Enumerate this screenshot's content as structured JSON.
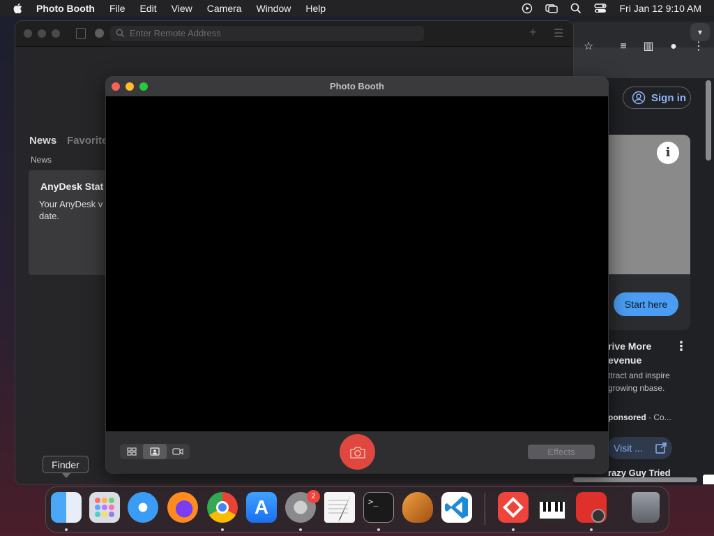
{
  "menubar": {
    "app": "Photo Booth",
    "items": [
      "File",
      "Edit",
      "View",
      "Camera",
      "Window",
      "Help"
    ],
    "clock": "Fri Jan 12  9:10 AM"
  },
  "anydesk": {
    "address_placeholder": "Enter Remote Address",
    "tab_news": "News",
    "tab_favorites": "Favorite",
    "section_label": "News",
    "news_title": "AnyDesk Stat",
    "news_body": "Your AnyDesk v to date."
  },
  "photobooth": {
    "title": "Photo Booth",
    "effects_label": "Effects"
  },
  "chrome": {
    "sign_in": "Sign in",
    "start_here": "Start here",
    "ad_title": "rive More evenue",
    "ad_desc": "ttract and inspire growing nbase.",
    "ad_sponsored": "ponsored",
    "ad_sponsored_suffix": "· Co...",
    "visit": "Visit ...",
    "next_title": "razy Guy Tried"
  },
  "dock": {
    "tooltip": "Finder",
    "settings_badge": "2",
    "apps": [
      "Finder",
      "Launchpad",
      "Safari",
      "Firefox",
      "Chrome",
      "App Store",
      "System Settings",
      "TextEdit",
      "Terminal",
      "GarageBand",
      "Visual Studio Code",
      "AnyDesk",
      "Piano",
      "Photo Booth",
      "Trash"
    ]
  },
  "colors": {
    "close": "#fe5f57",
    "minimize": "#febc2e",
    "zoom": "#28c840",
    "shutter": "#e0483f",
    "link": "#8ab4f8"
  }
}
